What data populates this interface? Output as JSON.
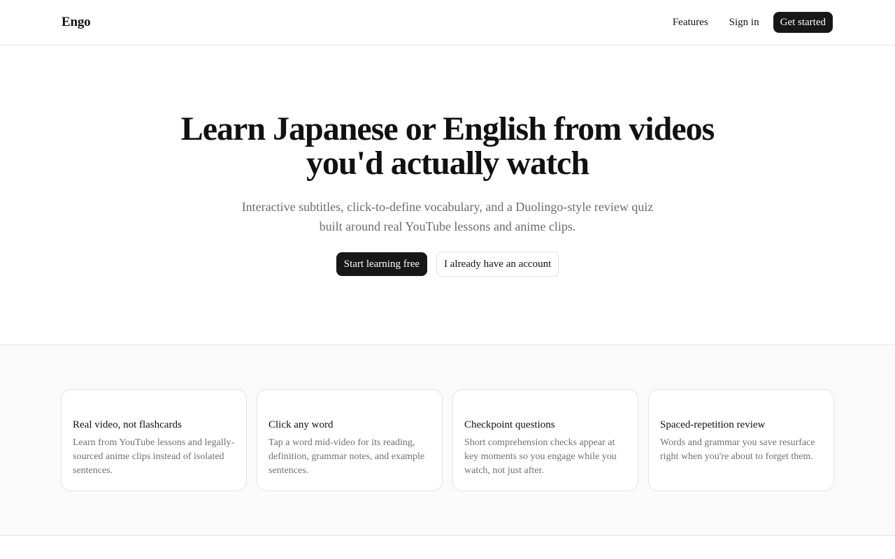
{
  "header": {
    "brand": "Engo",
    "nav": {
      "features": "Features",
      "sign_in": "Sign in",
      "get_started": "Get started"
    }
  },
  "hero": {
    "title": "Learn Japanese or English from videos you'd actually watch",
    "subtitle": "Interactive subtitles, click-to-define vocabulary, and a Duolingo-style review quiz built around real YouTube lessons and anime clips.",
    "primary_cta": "Start learning free",
    "secondary_cta": "I already have an account"
  },
  "features": [
    {
      "title": "Real video, not flashcards",
      "description": "Learn from YouTube lessons and legally-sourced anime clips instead of isolated sentences."
    },
    {
      "title": "Click any word",
      "description": "Tap a word mid-video for its reading, definition, grammar notes, and example sentences."
    },
    {
      "title": "Checkpoint questions",
      "description": "Short comprehension checks appear at key moments so you engage while you watch, not just after."
    },
    {
      "title": "Spaced-repetition review",
      "description": "Words and grammar you save resurface right when you're about to forget them."
    }
  ],
  "colors": {
    "primary_button": "#171717",
    "muted_text": "#6b6b6b",
    "band_background": "#fafafa",
    "border": "#e5e5e5"
  }
}
